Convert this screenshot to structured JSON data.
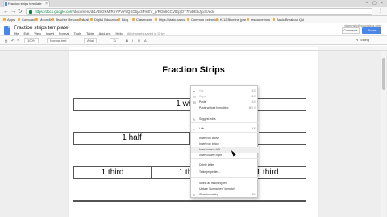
{
  "browser": {
    "tab_title": "Fraction strips template",
    "url_host": "https://docs.google.com",
    "url_path": "/document/d/1ABCfKMfRbYPVY9QXDbjA3PmEV_g/RGh6CCVtEpjOT7lhiDEbJjcdE/edit",
    "bookmarks": [
      "Apps",
      "Comcast",
      "Moon 4K",
      "Teacher Resources",
      "Mail",
      "Digital Education",
      "Blog",
      "Classroom",
      "https://static.canva",
      "Common extension",
      "K-12 Blueline (par",
      "resourcefinds",
      "Basic Breakout Qui"
    ]
  },
  "docs": {
    "title": "Fraction strips template",
    "menus": [
      "File",
      "Edit",
      "View",
      "Insert",
      "Format",
      "Tools",
      "Table",
      "Add-ons",
      "Help"
    ],
    "saved_status": "All changes saved in Drive",
    "account": "ckaminsky@soundapps.com",
    "comments_label": "Comments",
    "share_label": "Share",
    "toolbar": {
      "zoom": "100%",
      "style": "Normal text",
      "font": "Arial",
      "size": "11",
      "editing": "Editing"
    }
  },
  "page": {
    "heading": "Fraction Strips",
    "rows": [
      [
        "1 whole"
      ],
      [
        "1 half",
        ""
      ],
      [
        "1 third",
        "1 third",
        "1 third"
      ],
      [
        ""
      ]
    ]
  },
  "context_menu": {
    "items": [
      {
        "label": "Cut",
        "shortcut": "⌘X",
        "icon": "scissors-icon",
        "glyph": "✂",
        "disabled": true
      },
      {
        "label": "Copy",
        "shortcut": "⌘C",
        "icon": "copy-icon",
        "glyph": "▭",
        "disabled": true
      },
      {
        "label": "Paste",
        "shortcut": "⌘V",
        "icon": "paste-icon",
        "glyph": "▤",
        "disabled": false
      },
      {
        "label": "Paste without formatting",
        "shortcut": "⌘⇧V",
        "icon": "",
        "glyph": "",
        "disabled": false
      },
      {
        "label": "Suggest edits",
        "shortcut": "",
        "icon": "suggest-icon",
        "glyph": "✎",
        "disabled": false
      },
      {
        "label": "Link...",
        "shortcut": "⌘K",
        "icon": "link-icon",
        "glyph": "∞",
        "disabled": false
      },
      {
        "label": "Insert row above",
        "shortcut": "",
        "icon": "",
        "glyph": "",
        "disabled": false
      },
      {
        "label": "Insert row below",
        "shortcut": "",
        "icon": "",
        "glyph": "",
        "disabled": false
      },
      {
        "label": "Insert column left",
        "shortcut": "",
        "icon": "",
        "glyph": "",
        "disabled": false
      },
      {
        "label": "Insert column right",
        "shortcut": "",
        "icon": "",
        "glyph": "",
        "disabled": false
      },
      {
        "label": "Delete table",
        "shortcut": "",
        "icon": "",
        "glyph": "",
        "disabled": false
      },
      {
        "label": "Table properties...",
        "shortcut": "",
        "icon": "",
        "glyph": "",
        "disabled": false
      },
      {
        "label": "Select all matching text",
        "shortcut": "",
        "icon": "",
        "glyph": "",
        "disabled": false
      },
      {
        "label": "Update 'Normal text' to match",
        "shortcut": "",
        "icon": "",
        "glyph": "",
        "disabled": false
      },
      {
        "label": "Clear formatting",
        "shortcut": "⌘\\",
        "icon": "clear-format-icon",
        "glyph": "T̸",
        "disabled": false
      }
    ],
    "hovered_index": 8
  }
}
